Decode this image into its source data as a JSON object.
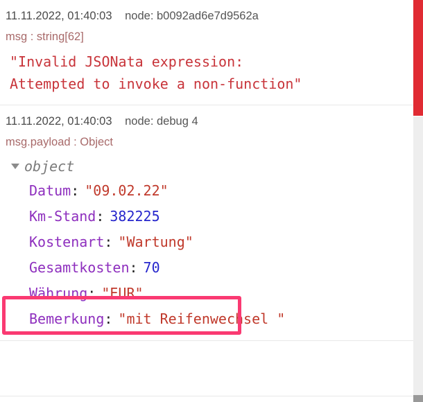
{
  "panel": {
    "name": "node-red-debug-sidebar",
    "background": "#ffffff"
  },
  "colors": {
    "error_stripe": "#e02b33",
    "highlight_box": "#fa3a72",
    "key_purple": "#8e2fbe",
    "string_red": "#c0392b",
    "number_blue": "#2626cc",
    "topic_rose": "#a86a6a",
    "meta_gray": "#4a4a4a",
    "object_gray": "#7a7a7a",
    "scrollbar_track": "#eeeeee",
    "scrollbar_thumb": "#999999"
  },
  "messages": [
    {
      "id": "message-error",
      "timestamp": "11.11.2022, 01:40:03",
      "node": "node: b0092ad6e7d9562a",
      "topic": "msg : string[62]",
      "kind": "error-string",
      "body": "\"Invalid JSONata expression:\nAttempted to invoke a non-function\""
    },
    {
      "id": "message-payload",
      "timestamp": "11.11.2022, 01:40:03",
      "node": "node: debug 4",
      "topic": "msg.payload : Object",
      "kind": "object",
      "expander": "triangle-down-icon",
      "root_label": "object",
      "properties": [
        {
          "key": "Datum",
          "value": "\"09.02.22\"",
          "type": "string"
        },
        {
          "key": "Km-Stand",
          "value": "382225",
          "type": "number"
        },
        {
          "key": "Kostenart",
          "value": "\"Wartung\"",
          "type": "string"
        },
        {
          "key": "Gesamtkosten",
          "value": "70",
          "type": "number",
          "highlighted": true
        },
        {
          "key": "Währung",
          "value": "\"EUR\"",
          "type": "string"
        },
        {
          "key": "Bemerkung",
          "value": "\"mit Reifenwechsel \"",
          "type": "string"
        }
      ]
    }
  ],
  "annotation": {
    "name": "highlight-rectangle",
    "target": "Gesamtkosten: 70",
    "color": "#fa3a72"
  },
  "scrollbar": {
    "name": "vertical-scrollbar",
    "thumb_position": "bottom"
  }
}
